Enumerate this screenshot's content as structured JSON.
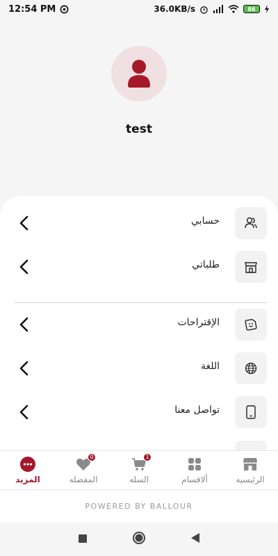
{
  "status": {
    "time": "12:54 PM",
    "speed": "36.0KB/s",
    "battery": "86"
  },
  "profile": {
    "username": "test"
  },
  "menu": [
    {
      "label": "حسابي",
      "icon": "users-icon"
    },
    {
      "label": "طلباتي",
      "icon": "store-icon"
    },
    {
      "label": "الإقتراحات",
      "icon": "sticker-icon"
    },
    {
      "label": "اللغة",
      "icon": "globe-icon"
    },
    {
      "label": "تواصل معنا",
      "icon": "phone-icon"
    }
  ],
  "nav": [
    {
      "label": "المزيد",
      "icon": "more-icon",
      "active": true
    },
    {
      "label": "المفضله",
      "icon": "heart-icon",
      "badge": "0"
    },
    {
      "label": "السله",
      "icon": "cart-icon",
      "badge": "1"
    },
    {
      "label": "ألاقسام",
      "icon": "grid-icon"
    },
    {
      "label": "الرئيسيه",
      "icon": "home-store-icon"
    }
  ],
  "powered_by": "POWERED BY BALLOUR",
  "colors": {
    "accent": "#a5182a",
    "avatar_bg": "#f0e0e1"
  }
}
